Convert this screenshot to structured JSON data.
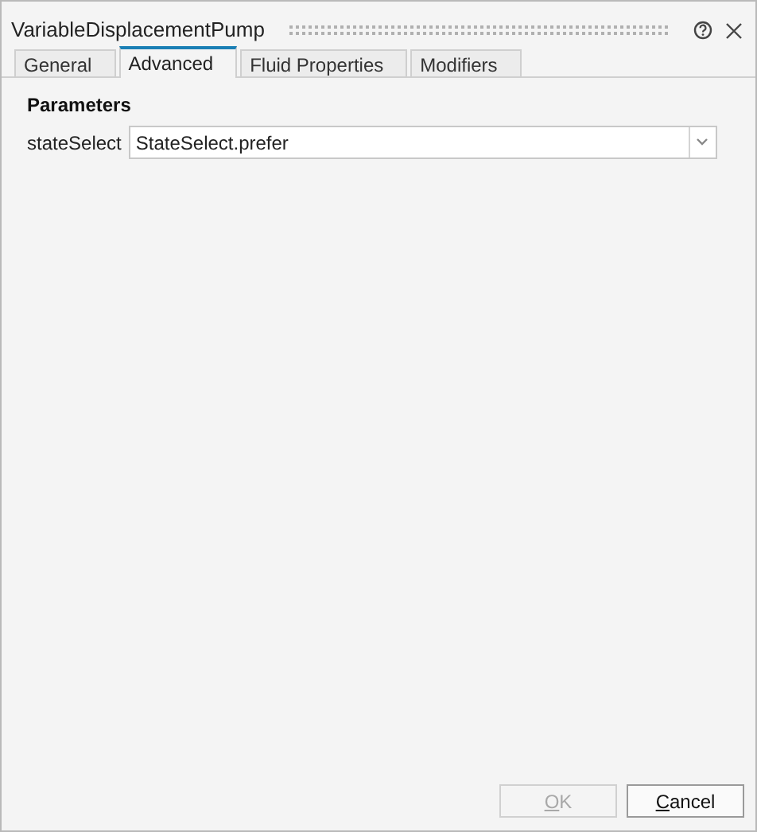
{
  "window": {
    "title": "VariableDisplacementPump"
  },
  "tabs": [
    {
      "label": "General",
      "selected": false
    },
    {
      "label": "Advanced",
      "selected": true
    },
    {
      "label": "Fluid Properties",
      "selected": false
    },
    {
      "label": "Modifiers",
      "selected": false
    }
  ],
  "section": {
    "title": "Parameters"
  },
  "parameters": [
    {
      "label": "stateSelect",
      "value": "StateSelect.prefer"
    }
  ],
  "buttons": [
    {
      "label": "OK",
      "disabled": true
    },
    {
      "label": "Cancel",
      "disabled": false
    }
  ]
}
